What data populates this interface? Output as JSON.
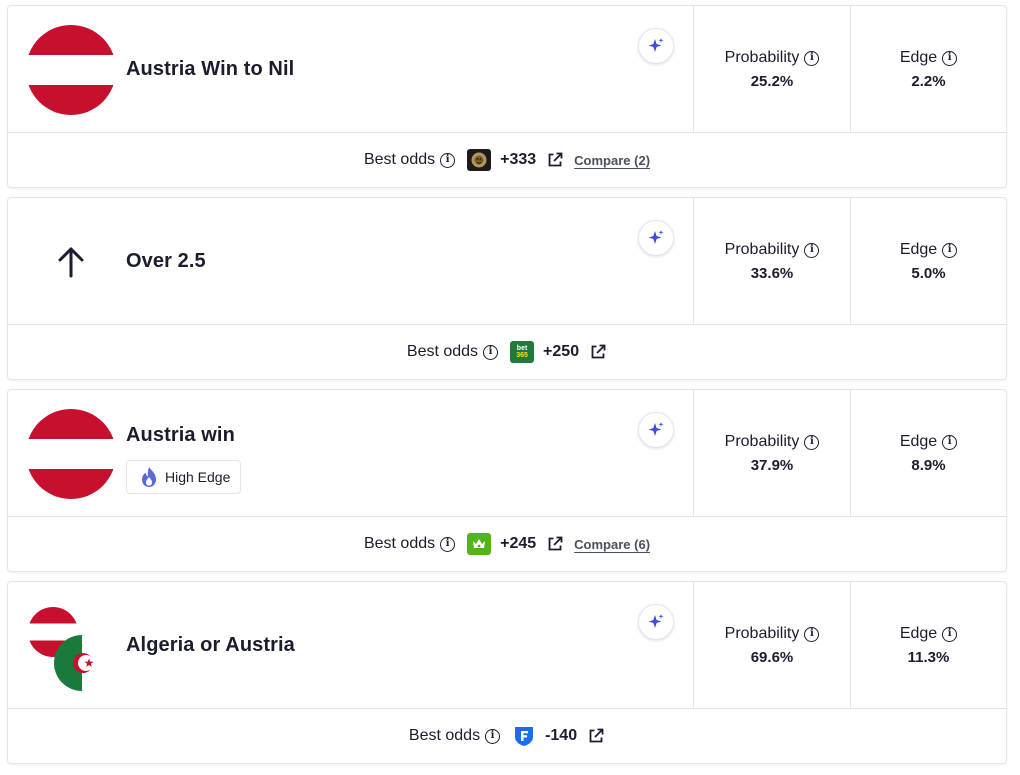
{
  "cards": [
    {
      "title": "Austria Win to Nil",
      "icon": "austria-flag",
      "probability_label": "Probability",
      "probability": "25.2%",
      "edge_label": "Edge",
      "edge": "2.2%",
      "best_odds_label": "Best odds",
      "bookmaker_logo": "mgm-lion-logo",
      "odds": "+333",
      "compare_label": "Compare (2)"
    },
    {
      "title": "Over 2.5",
      "icon": "arrow-up-icon",
      "probability_label": "Probability",
      "probability": "33.6%",
      "edge_label": "Edge",
      "edge": "5.0%",
      "best_odds_label": "Best odds",
      "bookmaker_logo": "bet365-logo",
      "bookmaker_logo_text": [
        "bet",
        "365"
      ],
      "odds": "+250"
    },
    {
      "title": "Austria win",
      "icon": "austria-flag",
      "badge_label": "High Edge",
      "probability_label": "Probability",
      "probability": "37.9%",
      "edge_label": "Edge",
      "edge": "8.9%",
      "best_odds_label": "Best odds",
      "bookmaker_logo": "draftkings-logo",
      "odds": "+245",
      "compare_label": "Compare (6)"
    },
    {
      "title": "Algeria or Austria",
      "icon": "austria-and-algeria-flags",
      "probability_label": "Probability",
      "probability": "69.6%",
      "edge_label": "Edge",
      "edge": "11.3%",
      "best_odds_label": "Best odds",
      "bookmaker_logo": "fanduel-logo",
      "odds": "-140"
    }
  ],
  "colors": {
    "text": "#1a1d2e",
    "border": "#e3e5ea",
    "accent_sparkle": "#3d4fd8",
    "austria_red": "#c8102e",
    "algeria_green": "#1a7a3b",
    "bet365_green": "#1f7a3c",
    "bet365_yellow": "#ffe11a",
    "draftkings_green": "#53b31a",
    "fanduel_blue": "#1c6ee8"
  }
}
